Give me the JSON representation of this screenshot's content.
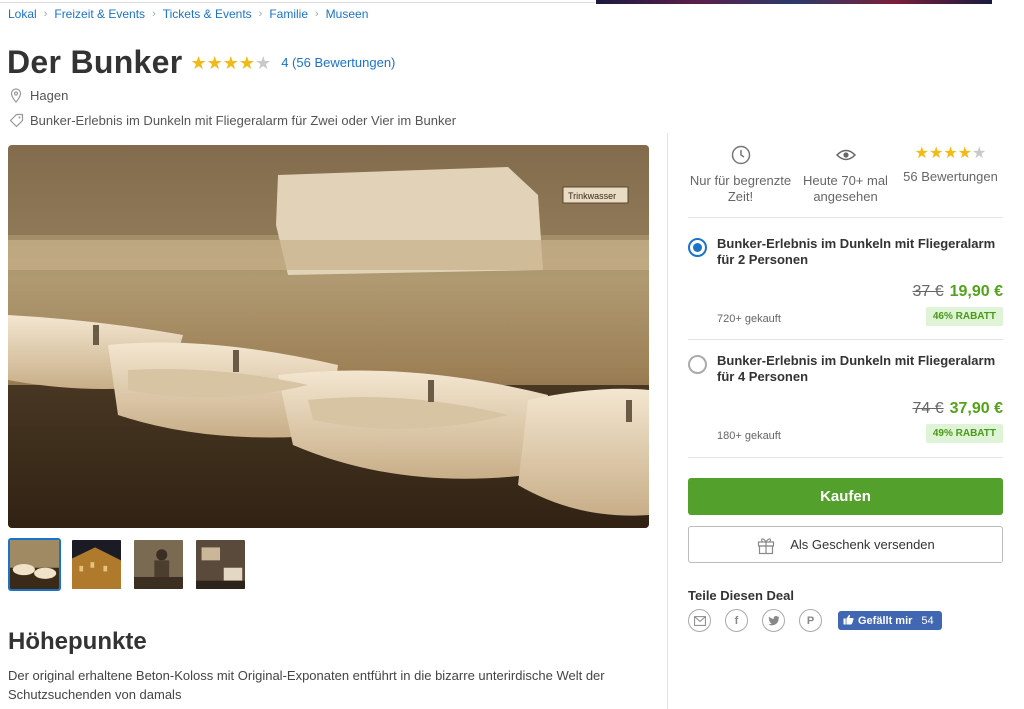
{
  "breadcrumb": [
    "Lokal",
    "Freizeit & Events",
    "Tickets & Events",
    "Familie",
    "Museen"
  ],
  "deal": {
    "title": "Der Bunker",
    "rating": 4,
    "rating_link": "4 (56 Bewertungen)",
    "location": "Hagen",
    "subtitle": "Bunker-Erlebnis im Dunkeln mit Fliegeralarm für Zwei oder Vier im Bunker"
  },
  "gallery": {
    "thumb_count": 4,
    "active_index": 0
  },
  "highlights": {
    "title": "Höhepunkte",
    "text": "Der original erhaltene Beton-Koloss mit Original-Exponaten entführt in die bizarre unterirdische Welt der Schutzsuchenden von damals"
  },
  "features": [
    {
      "icon": "clock-icon",
      "label": "Nur für begrenzte Zeit!"
    },
    {
      "icon": "eye-icon",
      "label": "Heute 70+ mal angesehen"
    },
    {
      "icon": "stars-icon",
      "rating": 4,
      "label": "56 Bewertungen"
    }
  ],
  "options": [
    {
      "title": "Bunker-Erlebnis im Dunkeln mit Fliegeralarm für 2 Personen",
      "old_price": "37 €",
      "new_price": "19,90 €",
      "bought": "720+ gekauft",
      "discount": "46% RABATT",
      "selected": true
    },
    {
      "title": "Bunker-Erlebnis im Dunkeln mit Fliegeralarm für 4 Personen",
      "old_price": "74 €",
      "new_price": "37,90 €",
      "bought": "180+ gekauft",
      "discount": "49% RABATT",
      "selected": false
    }
  ],
  "buttons": {
    "buy": "Kaufen",
    "gift": "Als Geschenk versenden"
  },
  "share": {
    "title": "Teile Diesen Deal",
    "like_label": "Gefällt mir",
    "like_count": "54"
  },
  "colors": {
    "accent_blue": "#1a73c9",
    "buy_green": "#53a02d",
    "price_green": "#53a318",
    "star": "#f5b915"
  }
}
